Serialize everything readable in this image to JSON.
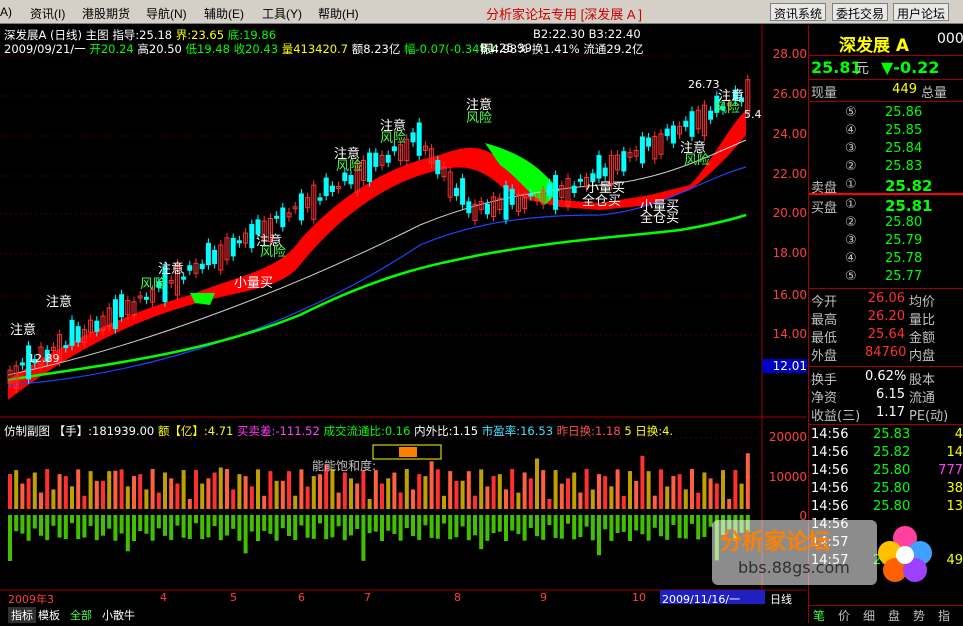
{
  "menu": {
    "items": [
      "A)",
      "资讯(I)",
      "港股期货",
      "导航(N)",
      "辅助(E)",
      "工具(Y)",
      "帮助(H)"
    ],
    "title": "分析家论坛专用 [深发展 A ]",
    "buttons": [
      "资讯系统",
      "委托交易",
      "用户论坛"
    ]
  },
  "header": {
    "stock": "深发展A (日线) 主图",
    "zhibiao": "指导:25.18",
    "jie": "界:23.65",
    "di": "底:19.86",
    "date": "2009/09/21/一",
    "open": "开20.24",
    "high": "高20.50",
    "low": "低19.48",
    "close": "收20.43",
    "vol": "量413420.7",
    "amount": "额8.23亿",
    "range": "幅-0.07(-0.34%)",
    "b1": "B1:25.39",
    "b2": "B2:22.30",
    "b3": "B3:22.40",
    "amp": "振4.98%",
    "turn": "换1.41%",
    "float": "流通29.2亿"
  },
  "yticks": [
    "28.00",
    "26.00",
    "24.00",
    "22.00",
    "20.00",
    "18.00",
    "16.00",
    "14.00"
  ],
  "price_tag": "12.01",
  "vol_ticks": [
    "20000",
    "10000",
    "0"
  ],
  "annotations": {
    "zhuyi": "注意",
    "fengxian": "风险",
    "xiaoliang": "小量买",
    "quancang": "全仓买",
    "high_label": "26.73",
    "low_label": "12.89",
    "right_label": "5.4",
    "saturation": "能能饱和度:"
  },
  "panel": {
    "name": "仿制副图",
    "shou": "【手】:181939.00",
    "e": "额【亿】:4.71",
    "mmc": "买卖差:-111.52",
    "cjlt": "成交流通比:0.16",
    "nwb": "内外比:1.15",
    "syl": "市盈率:16.53",
    "zrh": "昨日换:1.18",
    "wrh": "5 日换:4."
  },
  "xaxis": {
    "labels": [
      "2009年3",
      "4",
      "5",
      "6",
      "7",
      "8",
      "9",
      "10"
    ],
    "selected_date": "2009/11/16/一",
    "period": "日线"
  },
  "tabs": [
    "指标",
    "模板",
    "全部",
    "小散牛"
  ],
  "quote": {
    "name": "深发展 A",
    "code": "000",
    "price": "25.81",
    "unit": "元",
    "change": "▼-0.22",
    "xianliang_label": "现量",
    "xianliang": "449",
    "zongliang_label": "总量",
    "asks": [
      {
        "lvl": "⑤",
        "price": "25.86"
      },
      {
        "lvl": "④",
        "price": "25.85"
      },
      {
        "lvl": "③",
        "price": "25.84"
      },
      {
        "lvl": "②",
        "price": "25.83"
      },
      {
        "lvl": "①",
        "price": "25.82",
        "label": "卖盘"
      }
    ],
    "bids": [
      {
        "lvl": "①",
        "price": "25.81",
        "label": "买盘"
      },
      {
        "lvl": "②",
        "price": "25.80"
      },
      {
        "lvl": "③",
        "price": "25.79"
      },
      {
        "lvl": "④",
        "price": "25.78"
      },
      {
        "lvl": "⑤",
        "price": "25.77"
      }
    ],
    "stats": [
      {
        "l": "今开",
        "v": "26.06",
        "r": "均价"
      },
      {
        "l": "最高",
        "v": "26.20",
        "r": "量比"
      },
      {
        "l": "最低",
        "v": "25.64",
        "r": "金额"
      },
      {
        "l": "外盘",
        "v": "84760",
        "r": "内盘"
      }
    ],
    "stats2": [
      {
        "l": "换手",
        "v": "0.62%",
        "r": "股本"
      },
      {
        "l": "净资",
        "v": "6.15",
        "r": "流通"
      },
      {
        "l": "收益(三)",
        "v": "1.17",
        "r": "PE(动)"
      }
    ],
    "ticks": [
      {
        "t": "14:56",
        "p": "25.83",
        "v": "4"
      },
      {
        "t": "14:56",
        "p": "25.82",
        "v": "14"
      },
      {
        "t": "14:56",
        "p": "25.80",
        "v": "777"
      },
      {
        "t": "14:56",
        "p": "25.80",
        "v": "38"
      },
      {
        "t": "14:56",
        "p": "25.80",
        "v": "13"
      },
      {
        "t": "14:56",
        "p": "",
        "v": ""
      },
      {
        "t": "14:57",
        "p": "",
        "v": ""
      },
      {
        "t": "14:57",
        "p": "25.80",
        "v": "49"
      }
    ],
    "bottom_tabs": [
      "笔",
      "价",
      "细",
      "盘",
      "势",
      "指"
    ]
  },
  "watermark": {
    "title": "分析家论坛",
    "url": "bbs.88gs.com"
  },
  "colors": {
    "up": "#ff3030",
    "down": "#00ffff",
    "ribbon_red": "#ff0000",
    "ribbon_green": "#00ff00"
  }
}
